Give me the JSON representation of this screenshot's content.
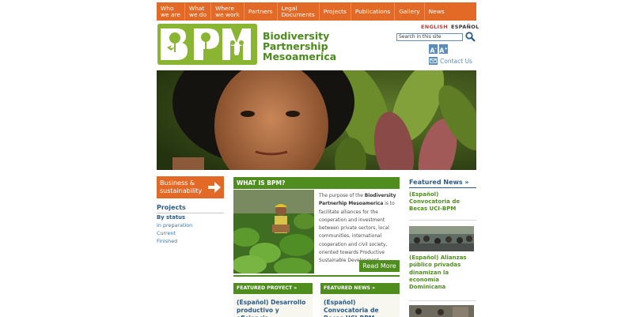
{
  "nav": {
    "items": [
      {
        "label": "Who\nwe are"
      },
      {
        "label": "What\nwe do"
      },
      {
        "label": "Where\nwe work"
      },
      {
        "label": "Partners"
      },
      {
        "label": "Legal\nDocuments"
      },
      {
        "label": "Projects"
      },
      {
        "label": "Publications"
      },
      {
        "label": "Gallery"
      },
      {
        "label": "News"
      }
    ]
  },
  "header": {
    "logo_text_line1": "Biodiversity",
    "logo_text_line2": "Partnership",
    "logo_text_line3": "Mesoamerica",
    "lang_english": "ENGLISH",
    "lang_spanish": "ESPAÑOL",
    "search_placeholder": "Search in this site",
    "font_decrease": "A",
    "font_increase": "A",
    "contact_label": "Contact Us"
  },
  "sidebar": {
    "business_button": "Business &\nsustainability",
    "projects_heading": "Projects",
    "by_status": "By status",
    "status_links": [
      "In preparation",
      "Current",
      "Finished"
    ]
  },
  "what_is": {
    "heading": "WHAT IS BPM?",
    "text_before": "The purpose of the ",
    "text_bold": "Biodiversity Partnerhip Mesoamerica",
    "text_after": " is to facilitate alliances for the cooperation and investment between private sectors, local communities, international cooperation and civil society, oriented towards Productive Sustainable Development ...",
    "read_more": "Read More"
  },
  "featured_project": {
    "heading": "FEATURED PROYECT »",
    "title": "(Español) Desarrollo productivo y eficiencia"
  },
  "featured_news_mid": {
    "heading": "FEATURED NEWS »",
    "title": "(Español) Convocatoria de Becas UCI-BPM"
  },
  "featured_news": {
    "heading": "Featured News »",
    "items": [
      "(Español) Convocatoria de Becas UCI-BPM",
      "(Español) Alianzas público privadas dinamizan la economía Dominicana"
    ]
  },
  "colors": {
    "nav_orange": "#e36a26",
    "brand_green": "#4f8e1e",
    "logo_green": "#8ab532",
    "link_blue": "#2a5a8a"
  }
}
